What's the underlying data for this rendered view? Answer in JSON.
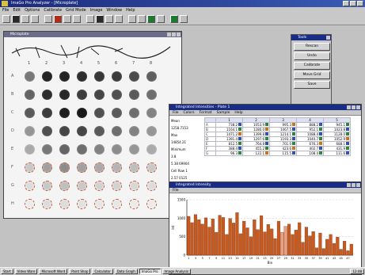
{
  "app": {
    "title": "ImaGo Pro Analyzer - [Microplate]",
    "menus": [
      "File",
      "Edit",
      "Options",
      "Calibrate",
      "Grid Mode",
      "Image",
      "Window",
      "Help"
    ]
  },
  "toolbar": {
    "tools": [
      "new",
      "open",
      "save",
      "crop",
      "rotate",
      "color",
      "zoom",
      "grid",
      "measure",
      "text",
      "histogram",
      "plot",
      "export",
      "print",
      "layout",
      "report",
      "settings",
      "help"
    ]
  },
  "plate_window": {
    "title": "Microplate",
    "column_labels": [
      "1",
      "2",
      "3",
      "4",
      "5",
      "6",
      "7",
      "8"
    ],
    "row_labels": [
      "A",
      "B",
      "C",
      "D",
      "E",
      "F",
      "G",
      "H"
    ]
  },
  "panel": {
    "title": "Tools",
    "buttons": [
      "Rescan",
      "Undo",
      "Calibrate",
      "Move Grid",
      "Save"
    ]
  },
  "data_window": {
    "title": "Integrated Intensities - Plate 1",
    "menus": [
      "File",
      "Colors",
      "Format",
      "Sample",
      "Help"
    ],
    "headers": [
      "",
      "1",
      "2",
      "3",
      "4",
      "5"
    ],
    "side_labels": [
      "Mean",
      "1258.7153",
      "Max",
      "14854.21",
      "Minimum",
      "3.8",
      "5.38 69904",
      "Cell Row 1",
      "2.57 0125"
    ],
    "rows": [
      {
        "label": "A",
        "cells": [
          "738.2",
          "1053.9",
          "995.3",
          "888.2",
          "945.1"
        ]
      },
      {
        "label": "B",
        "cells": [
          "1164.1",
          "1280.0",
          "1067.5",
          "952.1",
          "1023.8"
        ]
      },
      {
        "label": "C",
        "cells": [
          "1471.2",
          "1399.8",
          "1214.1",
          "1088.4",
          "1128.0"
        ]
      },
      {
        "label": "D",
        "cells": [
          "1391.4",
          "1297.6",
          "1193.3",
          "1040.7",
          "1052.9"
        ]
      },
      {
        "label": "E",
        "cells": [
          "812.5",
          "764.8",
          "701.0",
          "676.3",
          "688.1"
        ]
      },
      {
        "label": "F",
        "cells": [
          "388.4",
          "455.2",
          "423.6",
          "402.7",
          "431.9"
        ]
      },
      {
        "label": "G",
        "cells": [
          "96.3",
          "122.1",
          "115.5",
          "108.4",
          "111.6"
        ]
      }
    ]
  },
  "chart_window": {
    "title": "Integrated Intensity",
    "menus": [
      "File"
    ]
  },
  "taskbar": {
    "items": [
      "Start",
      "Video Ware",
      "Microsoft Word",
      "Paint Shop",
      "Calculator",
      "Data Graph",
      "ImaGo Pro",
      "Image Analysis"
    ],
    "clock": "12:48"
  },
  "colors": {
    "title_active": "#1a2d86",
    "bar_fill": "#c85a20",
    "bar_highlight": "#e8a080",
    "flag_green": "#2a8a3a",
    "flag_orange": "#d87010",
    "flag_blue": "#3050c0"
  },
  "chart_data": {
    "type": "bar",
    "categories": [
      "1",
      "2",
      "3",
      "4",
      "5",
      "6",
      "7",
      "8",
      "9",
      "10",
      "11",
      "12",
      "13",
      "14",
      "15",
      "16",
      "17",
      "18",
      "19",
      "20",
      "21",
      "22",
      "23",
      "24",
      "25",
      "26",
      "27",
      "28",
      "29",
      "30",
      "31",
      "32",
      "33",
      "34",
      "35",
      "36",
      "37",
      "38",
      "39",
      "40",
      "41",
      "42",
      "43",
      "44",
      "45",
      "46",
      "47",
      "48"
    ],
    "values": [
      1050,
      880,
      1100,
      960,
      840,
      1010,
      760,
      980,
      620,
      1080,
      1020,
      560,
      990,
      870,
      1150,
      580,
      920,
      740,
      500,
      960,
      690,
      1070,
      630,
      830,
      710,
      450,
      920,
      620,
      780,
      840,
      560,
      680,
      880,
      350,
      760,
      520,
      640,
      200,
      600,
      180,
      430,
      560,
      320,
      490,
      160,
      380,
      120,
      300
    ],
    "ylim": [
      0,
      1500
    ],
    "yticks": [
      "1500",
      "1000",
      "500",
      "0"
    ],
    "xlabel": "Bin",
    "ylabel": "Int"
  }
}
